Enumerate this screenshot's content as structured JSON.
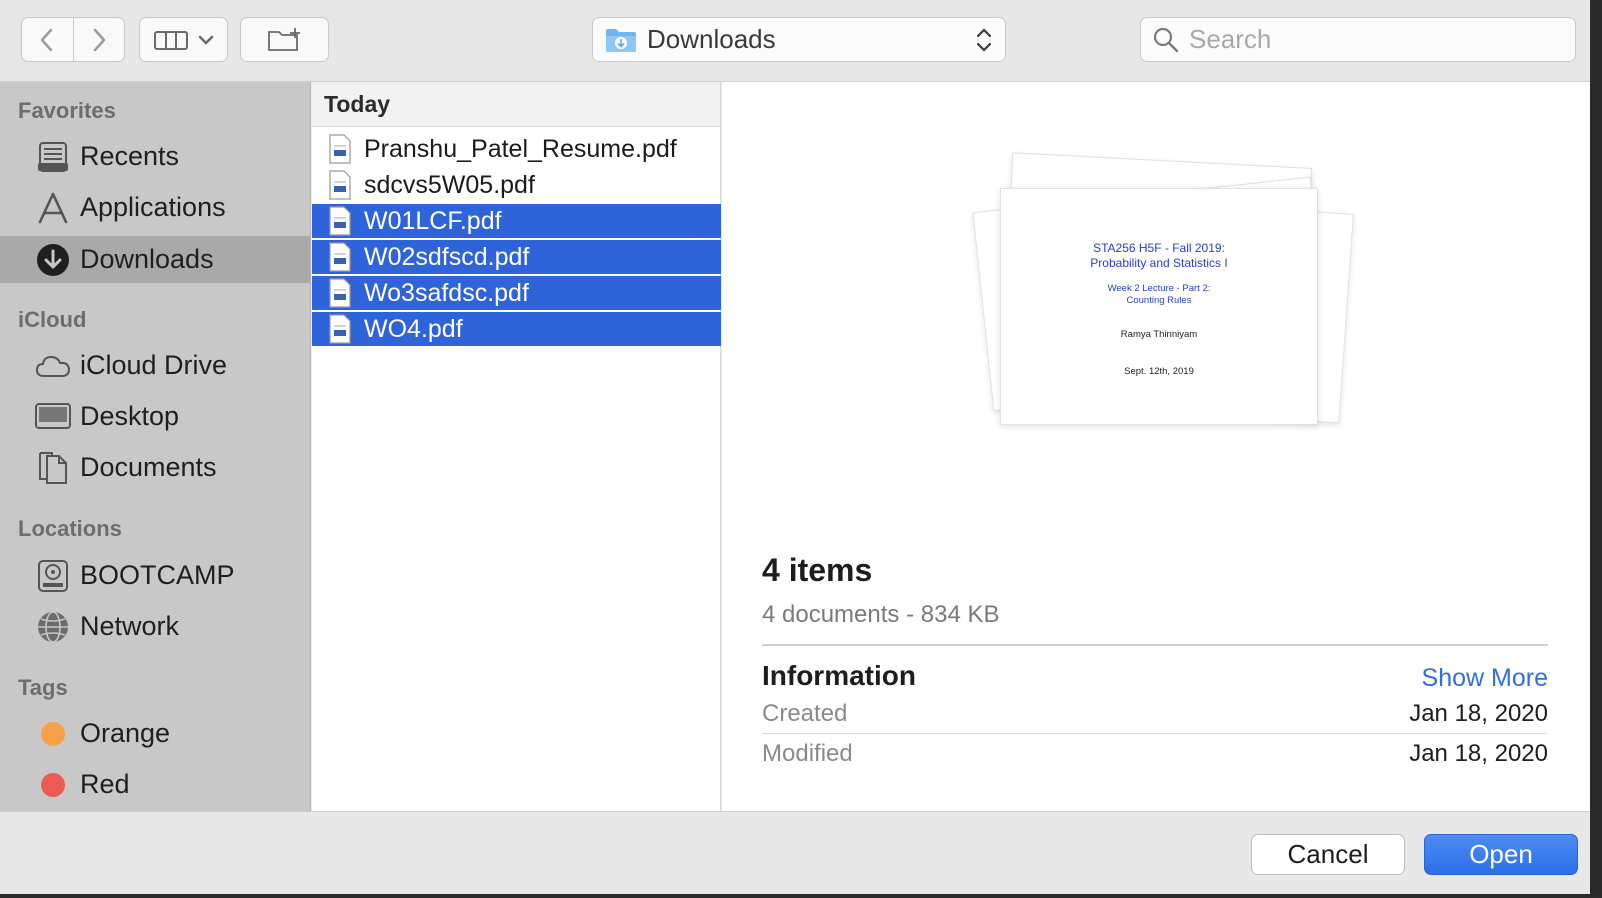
{
  "toolbar": {
    "back_icon": "chevron-left-icon",
    "forward_icon": "chevron-right-icon",
    "view_icon": "column-view-icon",
    "new_folder_icon": "new-folder-icon",
    "location": "Downloads",
    "search_placeholder": "Search"
  },
  "sidebar": {
    "favorites_title": "Favorites",
    "favorites": [
      {
        "label": "Recents",
        "icon": "recents-icon"
      },
      {
        "label": "Applications",
        "icon": "applications-icon"
      },
      {
        "label": "Downloads",
        "icon": "downloads-icon",
        "selected": true
      }
    ],
    "icloud_title": "iCloud",
    "icloud": [
      {
        "label": "iCloud Drive",
        "icon": "cloud-icon"
      },
      {
        "label": "Desktop",
        "icon": "desktop-icon"
      },
      {
        "label": "Documents",
        "icon": "documents-icon"
      }
    ],
    "locations_title": "Locations",
    "locations": [
      {
        "label": "BOOTCAMP",
        "icon": "disk-icon"
      },
      {
        "label": "Network",
        "icon": "network-icon"
      }
    ],
    "tags_title": "Tags",
    "tags": [
      {
        "label": "Orange",
        "color": "#f5a14a"
      },
      {
        "label": "Red",
        "color": "#ec5b53"
      }
    ]
  },
  "file_list": {
    "header": "Today",
    "files": [
      {
        "name": "Pranshu_Patel_Resume.pdf",
        "selected": false
      },
      {
        "name": "sdcvs5W05.pdf",
        "selected": false
      },
      {
        "name": "W01LCF.pdf",
        "selected": true
      },
      {
        "name": "W02sdfscd.pdf",
        "selected": true
      },
      {
        "name": "Wo3safdsc.pdf",
        "selected": true
      },
      {
        "name": "WO4.pdf",
        "selected": true
      }
    ]
  },
  "preview": {
    "page_title_line1": "STA256 H5F - Fall 2019:",
    "page_title_line2": "Probability and Statistics I",
    "page_sub_line1": "Week 2 Lecture - Part 2:",
    "page_sub_line2": "Counting Rules",
    "page_author": "Ramya Thinniyam",
    "page_date": "Sept. 12th, 2019",
    "count": "4 items",
    "summary": "4 documents - 834 KB",
    "info_title": "Information",
    "show_more": "Show More",
    "created_label": "Created",
    "created_value": "Jan 18, 2020",
    "modified_label": "Modified",
    "modified_value": "Jan 18, 2020"
  },
  "buttons": {
    "cancel": "Cancel",
    "open": "Open"
  },
  "colors": {
    "selection": "#2f63d9",
    "accent": "#2f6fe0"
  }
}
